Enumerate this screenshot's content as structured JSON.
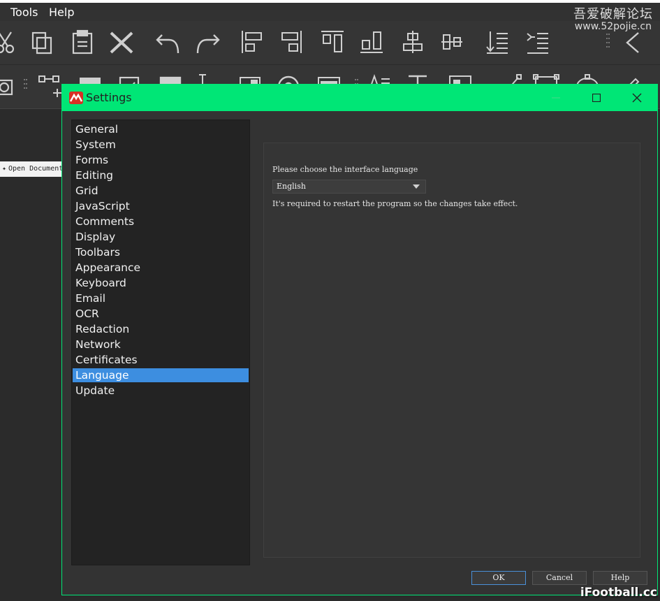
{
  "menu": {
    "items": [
      {
        "label": "Tools"
      },
      {
        "label": "Help"
      }
    ]
  },
  "watermark": {
    "title": "吾爱破解论坛",
    "url": "www.52pojie.cn",
    "corner": "iFootball.cc"
  },
  "background": {
    "open_document_label": "Open Document"
  },
  "dialog": {
    "title": "Settings",
    "accent_color": "#00e676",
    "nav_items": [
      {
        "label": "General"
      },
      {
        "label": "System"
      },
      {
        "label": "Forms"
      },
      {
        "label": "Editing"
      },
      {
        "label": "Grid"
      },
      {
        "label": "JavaScript"
      },
      {
        "label": "Comments"
      },
      {
        "label": "Display"
      },
      {
        "label": "Toolbars"
      },
      {
        "label": "Appearance"
      },
      {
        "label": "Keyboard"
      },
      {
        "label": "Email"
      },
      {
        "label": "OCR"
      },
      {
        "label": "Redaction"
      },
      {
        "label": "Network"
      },
      {
        "label": "Certificates"
      },
      {
        "label": "Language"
      },
      {
        "label": "Update"
      }
    ],
    "selected_nav": "Language",
    "language": {
      "prompt": "Please choose the interface language",
      "selected_value": "English",
      "note": "It's required to restart the program so the changes take effect."
    },
    "buttons": {
      "ok": "OK",
      "cancel": "Cancel",
      "help": "Help"
    }
  }
}
